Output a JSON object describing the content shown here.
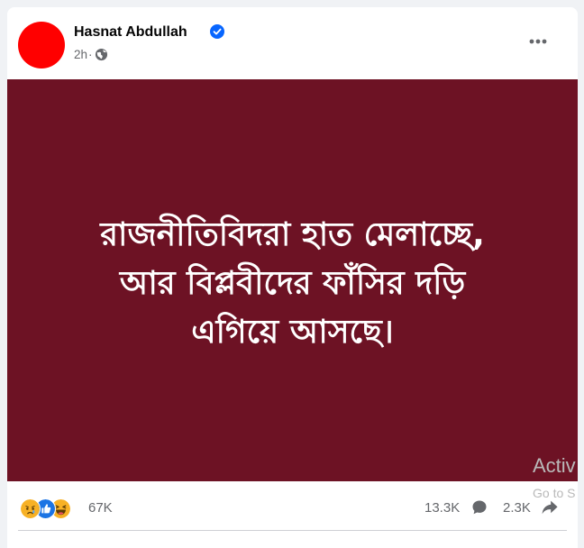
{
  "post": {
    "author": {
      "name": "Hasnat Abdullah",
      "verified": true,
      "avatar_color": "#ff0000",
      "verified_icon": "verified-badge-icon"
    },
    "time": "2h",
    "separator": "·",
    "audience_icon": "globe-icon",
    "more_icon": "more-options-icon",
    "image": {
      "background_color": "#6d1224",
      "text_color": "#ffffff",
      "lines": [
        "রাজনীতিবিদরা হাত মেলাচ্ছে,",
        "আর বিপ্লবীদের ফাঁসির দড়ি",
        "এগিয়ে আসছে।"
      ]
    }
  },
  "engagement": {
    "reaction_icons": [
      "sad-reaction-icon",
      "like-reaction-icon",
      "haha-reaction-icon"
    ],
    "reactions_count": "67K",
    "comments_count": "13.3K",
    "comment_icon": "comment-icon",
    "shares_count": "2.3K",
    "share_icon": "share-icon"
  },
  "overlay": {
    "watermark_title": "Activ",
    "watermark_sub": "Go to S"
  }
}
